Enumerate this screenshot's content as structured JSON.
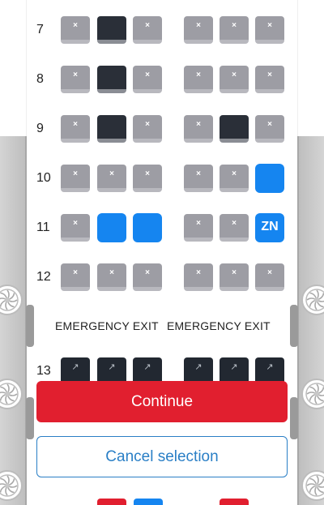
{
  "rows": [
    {
      "number": "7",
      "left": [
        "taken",
        "dark",
        "taken"
      ],
      "right": [
        "taken",
        "taken",
        "taken"
      ]
    },
    {
      "number": "8",
      "left": [
        "taken",
        "dark",
        "taken"
      ],
      "right": [
        "taken",
        "taken",
        "taken"
      ]
    },
    {
      "number": "9",
      "left": [
        "taken",
        "dark",
        "taken"
      ],
      "right": [
        "taken",
        "dark",
        "taken"
      ]
    },
    {
      "number": "10",
      "left": [
        "taken",
        "taken",
        "taken"
      ],
      "right": [
        "taken",
        "taken",
        "blue"
      ]
    },
    {
      "number": "11",
      "left": [
        "taken",
        "blue",
        "blue"
      ],
      "right": [
        "taken",
        "taken",
        "selected"
      ]
    },
    {
      "number": "12",
      "left": [
        "taken",
        "taken",
        "taken"
      ],
      "right": [
        "taken",
        "taken",
        "taken"
      ]
    },
    {
      "number": "13",
      "left": [
        "exit",
        "exit",
        "exit"
      ],
      "right": [
        "exit",
        "exit",
        "exit"
      ]
    }
  ],
  "seat_symbols": {
    "taken": "×",
    "exit": "↗"
  },
  "selected_seat_code": "ZN",
  "emergency": {
    "left": "EMERGENCY EXIT",
    "right": "EMERGENCY EXIT"
  },
  "buttons": {
    "continue": "Continue",
    "cancel": "Cancel selection"
  },
  "colors": {
    "accent_red": "#e11f2f",
    "accent_blue": "#1585f0",
    "link_blue": "#2a7fc6"
  },
  "icons": {
    "engine": "fan-icon"
  }
}
